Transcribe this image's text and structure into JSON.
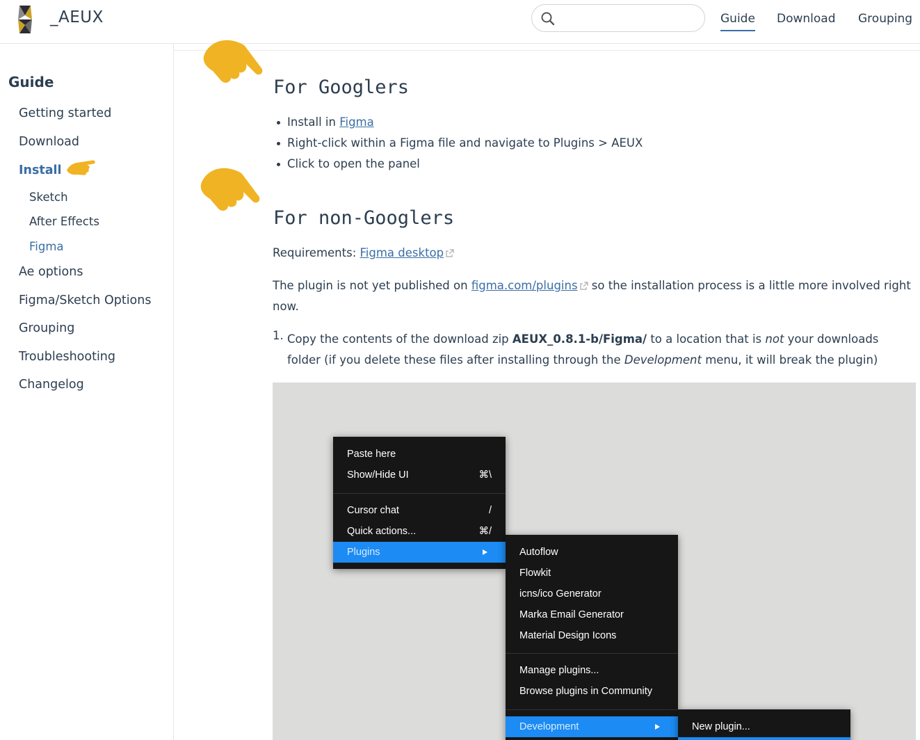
{
  "header": {
    "site_name": "_AEUX",
    "search_placeholder": "",
    "nav": [
      "Guide",
      "Download",
      "Grouping"
    ]
  },
  "sidebar": {
    "heading": "Guide",
    "items": [
      "Getting started",
      "Download",
      "Install",
      "Ae options",
      "Figma/Sketch Options",
      "Grouping",
      "Troubleshooting",
      "Changelog"
    ],
    "sub_items": [
      "Sketch",
      "After Effects",
      "Figma"
    ],
    "active_item": "Install",
    "active_sub_item": "Figma"
  },
  "content": {
    "googlers": {
      "title": "For Googlers",
      "b1_prefix": "Install in ",
      "b1_link": "Figma",
      "b2": "Right-click within a Figma file and navigate to Plugins > AEUX",
      "b3": "Click to open the panel"
    },
    "non_googlers": {
      "title": "For non-Googlers",
      "req_prefix": "Requirements: ",
      "req_link": "Figma desktop",
      "p_prefix": "The plugin is not yet published on ",
      "p_link": "figma.com/plugins",
      "p_suffix": " so the installation process is a little more involved right now.",
      "step_number": "1.",
      "step_a": "Copy the contents of the download zip ",
      "step_bold": "AEUX_0.8.1-b/Figma/",
      "step_b": " to a location that is ",
      "step_not": "not",
      "step_c": " your downloads folder (if you delete these files after installing through the ",
      "step_dev": "Development",
      "step_d": " menu, it will break the plugin)"
    },
    "figma_menu": {
      "main": [
        {
          "label": "Paste here",
          "shortcut": ""
        },
        {
          "label": "Show/Hide UI",
          "shortcut": "⌘\\"
        },
        {
          "label": "Cursor chat",
          "shortcut": "/"
        },
        {
          "label": "Quick actions...",
          "shortcut": "⌘/"
        },
        {
          "label": "Plugins",
          "shortcut": ""
        }
      ],
      "plugins": [
        "Autoflow",
        "Flowkit",
        "icns/ico Generator",
        "Marka Email Generator",
        "Material Design Icons",
        "Manage plugins...",
        "Browse plugins in Community",
        "Development"
      ],
      "development": [
        "New plugin..."
      ]
    }
  },
  "colors": {
    "accent": "#3a6ea5",
    "hand": "#f0b323",
    "menu_bg": "#161616",
    "menu_highlight": "#1c8bf3"
  },
  "icons": [
    "aeux-logo-icon",
    "search-icon",
    "pointing-hand-icon",
    "external-link-icon",
    "submenu-arrow-icon"
  ]
}
